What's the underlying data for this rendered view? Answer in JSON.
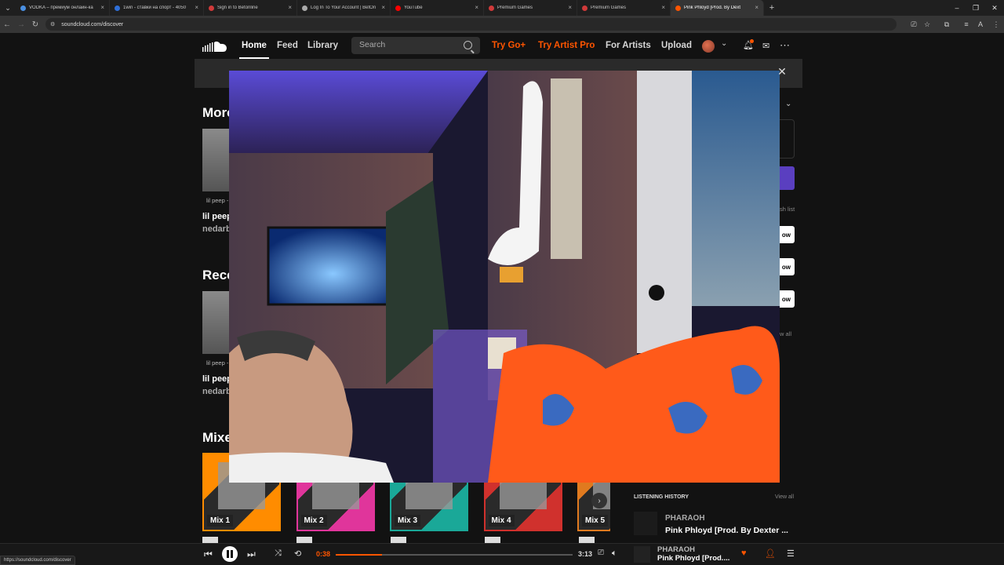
{
  "browser": {
    "tabs": [
      {
        "label": "VODKA – премиум онлайн-ка",
        "icon": "vodka-icon",
        "color": "#4a90e2"
      },
      {
        "label": "1win - ставки на спорт - 4050",
        "icon": "1win-icon",
        "color": "#2e6fd8"
      },
      {
        "label": "Sign in to Betonline",
        "icon": "betonline-icon",
        "color": "#d03a3a"
      },
      {
        "label": "Log In To Your Account | BetOn",
        "icon": "globe-icon",
        "color": "#aaaaaa"
      },
      {
        "label": "YouTube",
        "icon": "youtube-icon",
        "color": "#ff0000"
      },
      {
        "label": "Premium Games",
        "icon": "premium-icon",
        "color": "#d03a3a"
      },
      {
        "label": "Premium Games",
        "icon": "premium-icon",
        "color": "#d03a3a"
      },
      {
        "label": "Pink Phloyd [Prod. By Dext",
        "icon": "soundcloud-icon",
        "color": "#ff5500"
      }
    ],
    "url": "soundcloud.com/discover",
    "status_url": "https://soundcloud.com/discover"
  },
  "header": {
    "home": "Home",
    "feed": "Feed",
    "library": "Library",
    "search_placeholder": "Search",
    "try_go": "Try Go+",
    "try_artist_pro": "Try Artist Pro",
    "for_artists": "For Artists",
    "upload": "Upload"
  },
  "sections": {
    "more_of": "More",
    "recent": "Rece",
    "mixed": "Mixe"
  },
  "cards": {
    "more_small": "lil peep -",
    "more_title": "lil peep",
    "more_user": "nedarb",
    "recent_small": "lil peep -",
    "recent_title": "lil peep",
    "recent_user": "nedarb"
  },
  "mixes": [
    {
      "label": "Mix 1",
      "color": "#ff8c00"
    },
    {
      "label": "Mix 2",
      "color": "#e0359b"
    },
    {
      "label": "Mix 3",
      "color": "#1aa898"
    },
    {
      "label": "Mix 4",
      "color": "#d0312d"
    },
    {
      "label": "Mix 5",
      "color": "#e07a1f"
    }
  ],
  "right_panel": {
    "follow_partial": "ow",
    "view_all_partial": "w all",
    "wish_list_partial": "sh list",
    "history_label": "LISTENING HISTORY",
    "history_viewall": "View all",
    "history_artist": "PHARAOH",
    "history_title": "Pink Phloyd [Prod. By Dexter ..."
  },
  "player": {
    "elapsed": "0:38",
    "duration": "3:13",
    "progress": 0.197,
    "artist": "PHARAOH",
    "title": "Pink Phloyd [Prod...."
  }
}
